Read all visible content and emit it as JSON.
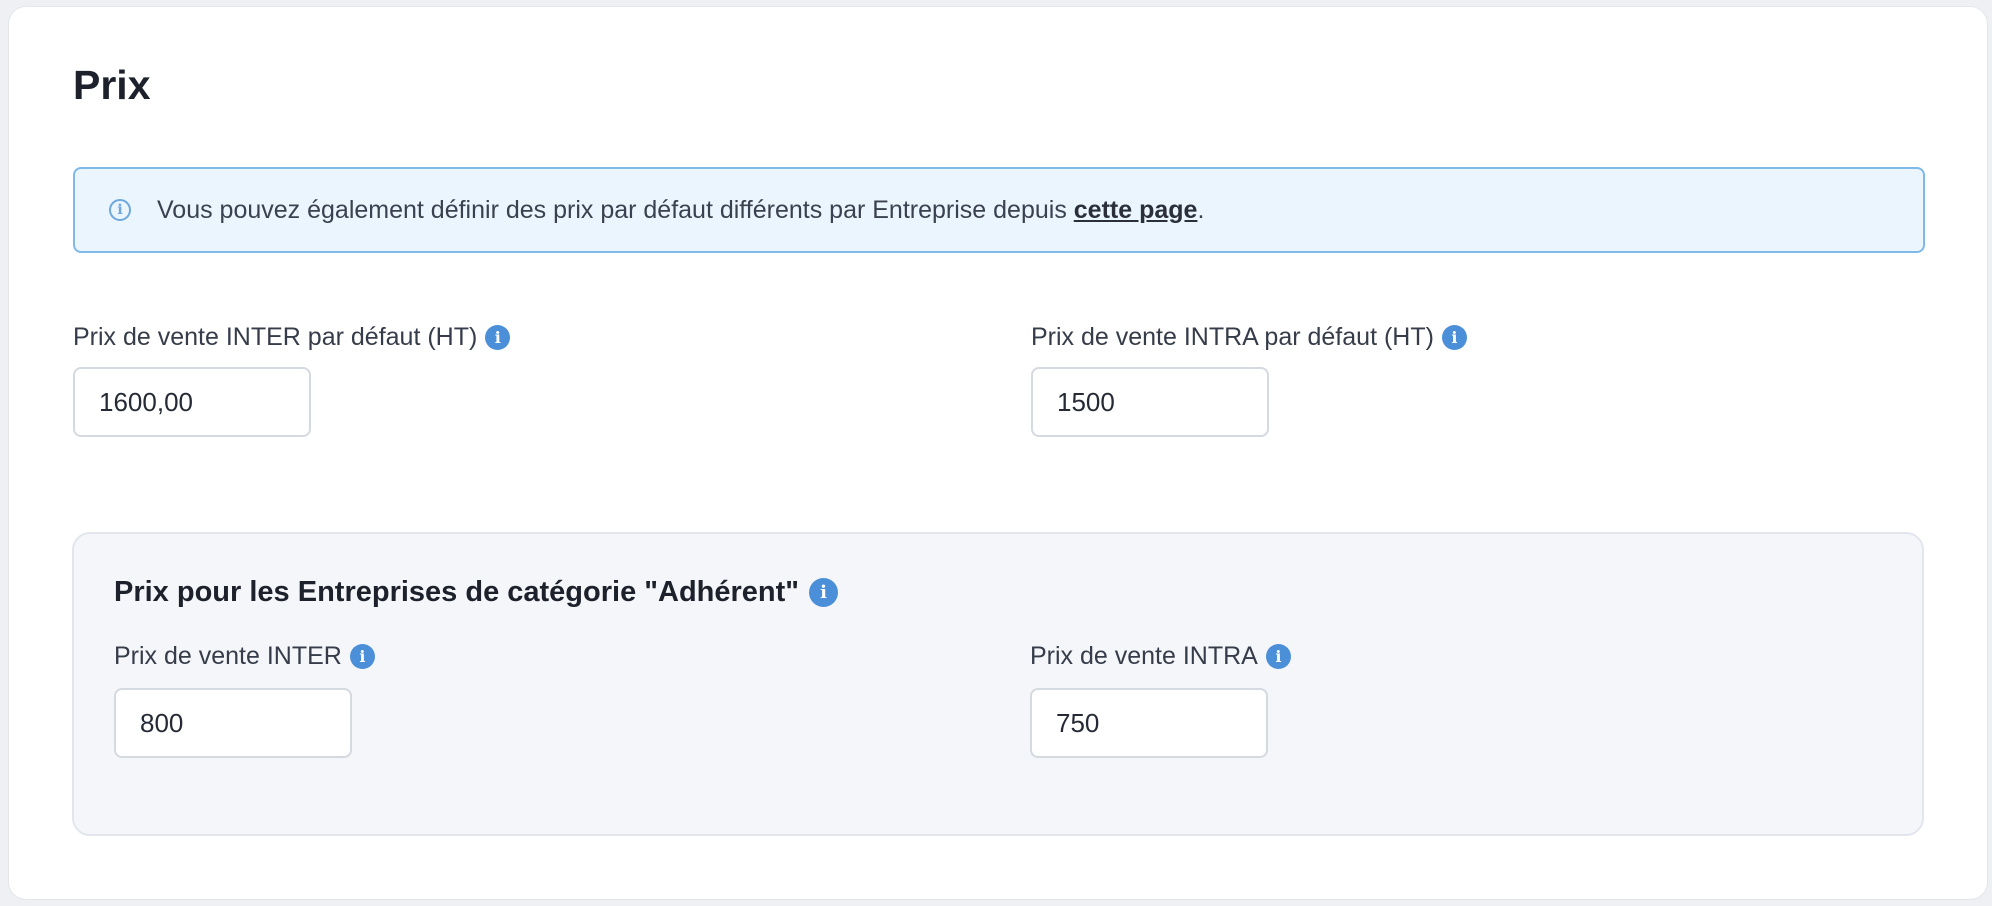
{
  "section": {
    "title": "Prix"
  },
  "info_banner": {
    "text_before": "Vous pouvez également définir des prix par défaut différents par Entreprise depuis ",
    "link_text": "cette page",
    "text_after": "."
  },
  "default_prices": {
    "inter_label": "Prix de vente INTER par défaut (HT)",
    "inter_value": "1600,00",
    "intra_label": "Prix de vente INTRA par défaut (HT)",
    "intra_value": "1500"
  },
  "category_prices": {
    "title": "Prix pour les Entreprises de catégorie \"Adhérent\"",
    "inter_label": "Prix de vente INTER",
    "inter_value": "800",
    "intra_label": "Prix de vente INTRA",
    "intra_value": "750"
  },
  "icons": {
    "info": "info-icon",
    "info_outline": "info-outline-icon"
  },
  "colors": {
    "accent": "#4a8fd8",
    "banner_bg": "#eaf5fd",
    "banner_border": "#7fb9e8",
    "panel_bg": "#f4f6f9"
  }
}
